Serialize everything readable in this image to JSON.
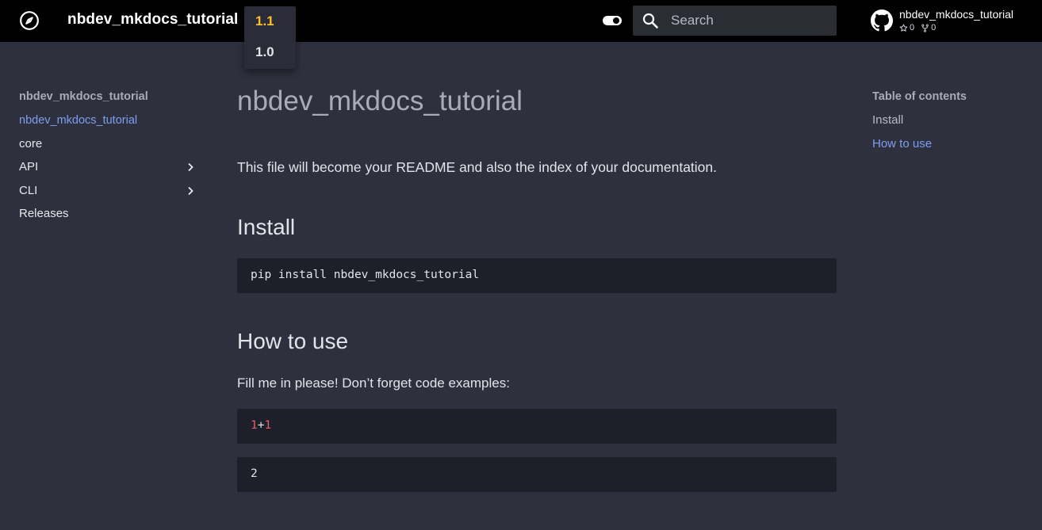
{
  "header": {
    "site_title": "nbdev_mkdocs_tutorial",
    "logo_icon": "compass-icon",
    "versions": [
      "1.1",
      "1.0"
    ],
    "search_placeholder": "Search",
    "repo": {
      "name": "nbdev_mkdocs_tutorial",
      "stars": "0",
      "forks": "0"
    }
  },
  "sidebar": {
    "title": "nbdev_mkdocs_tutorial",
    "items": [
      {
        "label": "nbdev_mkdocs_tutorial",
        "active": true
      },
      {
        "label": "core"
      },
      {
        "label": "API",
        "expandable": true
      },
      {
        "label": "CLI",
        "expandable": true
      },
      {
        "label": "Releases"
      }
    ]
  },
  "main": {
    "title": "nbdev_mkdocs_tutorial",
    "intro": "This file will become your README and also the index of your documentation.",
    "install_heading": "Install",
    "install_code": "pip install nbdev_mkdocs_tutorial",
    "howto_heading": "How to use",
    "howto_text": "Fill me in please! Don’t forget code examples:",
    "code_example": {
      "left": "1",
      "op": "+",
      "right": "1"
    },
    "output": "2"
  },
  "toc": {
    "title": "Table of contents",
    "items": [
      "Install",
      "How to use"
    ]
  },
  "colors": {
    "header_bg": "#000000",
    "page_bg": "#2e303e",
    "accent": "#7e9ef0",
    "active_version": "#fbc02d",
    "code_bg": "#1e2029",
    "code_number": "#e25d65"
  }
}
